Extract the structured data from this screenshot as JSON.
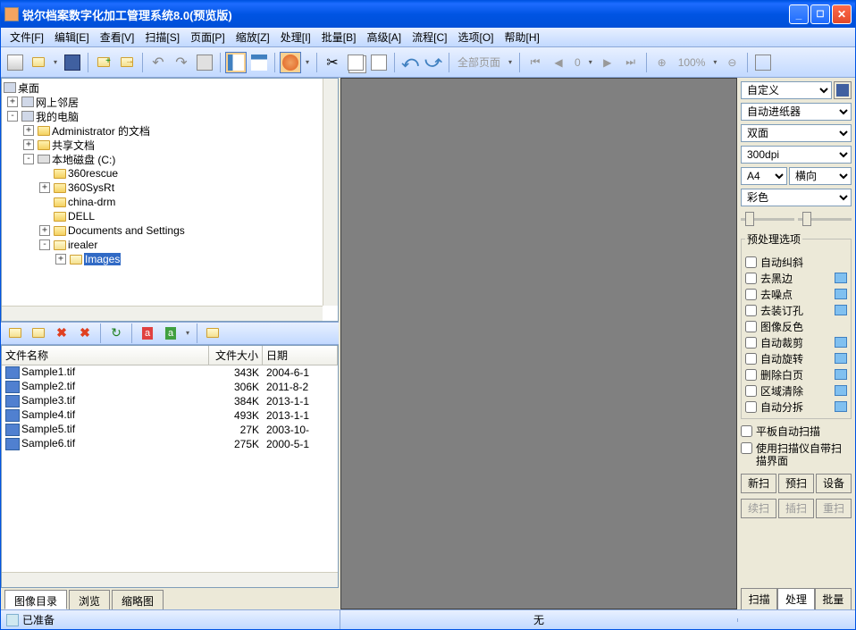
{
  "title": "锐尔档案数字化加工管理系统8.0(预览版)",
  "menus": [
    "文件[F]",
    "编辑[E]",
    "查看[V]",
    "扫描[S]",
    "页面[P]",
    "缩放[Z]",
    "处理[I]",
    "批量[B]",
    "高级[A]",
    "流程[C]",
    "选项[O]",
    "帮助[H]"
  ],
  "toolbar": {
    "page_label": "全部页面",
    "page_num": "0",
    "zoom": "100%"
  },
  "tree": {
    "root": "桌面",
    "neighbor": "网上邻居",
    "mycomputer": "我的电脑",
    "admin_docs": "Administrator 的文档",
    "shared_docs": "共享文档",
    "local_disk": "本地磁盘 (C:)",
    "folders": [
      "360rescue",
      "360SysRt",
      "china-drm",
      "DELL",
      "Documents and Settings",
      "irealer"
    ],
    "images": "Images"
  },
  "filelist": {
    "columns": [
      "文件名称",
      "文件大小",
      "日期"
    ],
    "rows": [
      {
        "name": "Sample1.tif",
        "size": "343K",
        "date": "2004-6-1"
      },
      {
        "name": "Sample2.tif",
        "size": "306K",
        "date": "2011-8-2"
      },
      {
        "name": "Sample3.tif",
        "size": "384K",
        "date": "2013-1-1"
      },
      {
        "name": "Sample4.tif",
        "size": "493K",
        "date": "2013-1-1"
      },
      {
        "name": "Sample5.tif",
        "size": "27K",
        "date": "2003-10-"
      },
      {
        "name": "Sample6.tif",
        "size": "275K",
        "date": "2000-5-1"
      }
    ]
  },
  "left_tabs": [
    "图像目录",
    "浏览",
    "缩略图"
  ],
  "right": {
    "preset": "自定义",
    "feeder": "自动进纸器",
    "duplex": "双面",
    "dpi": "300dpi",
    "paper": "A4",
    "orientation": "横向",
    "color": "彩色",
    "prep_title": "预处理选项",
    "prep_items": [
      {
        "label": "自动纠斜",
        "cfg": false
      },
      {
        "label": "去黑边",
        "cfg": true
      },
      {
        "label": "去噪点",
        "cfg": true
      },
      {
        "label": "去装订孔",
        "cfg": true
      },
      {
        "label": "图像反色",
        "cfg": false
      },
      {
        "label": "自动裁剪",
        "cfg": true
      },
      {
        "label": "自动旋转",
        "cfg": true
      },
      {
        "label": "删除白页",
        "cfg": true
      },
      {
        "label": "区域清除",
        "cfg": true
      },
      {
        "label": "自动分拆",
        "cfg": true
      }
    ],
    "flatbed": "平板自动扫描",
    "native_ui": "使用扫描仪自带扫描界面",
    "btns1": [
      "新扫",
      "预扫",
      "设备"
    ],
    "btns2": [
      "续扫",
      "插扫",
      "重扫"
    ],
    "tabs": [
      "扫描",
      "处理",
      "批量"
    ]
  },
  "status": {
    "ready": "已准备",
    "center": "无"
  }
}
